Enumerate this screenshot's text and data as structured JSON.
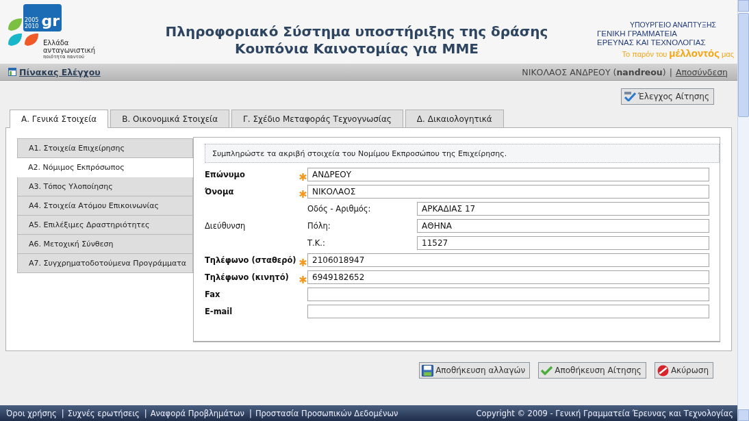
{
  "header": {
    "logo": {
      "mark": "gr",
      "years": [
        "2005",
        "2010"
      ],
      "lines": [
        "Ελλάδα",
        "ανταγωνιστική"
      ],
      "tagline": "ποιότητα παντού"
    },
    "title": [
      "Πληροφοριακό Σύστημα υποστήριξης της δράσης",
      "Κουπόνια Καινοτομίας για ΜΜΕ"
    ],
    "ministry": {
      "lines": [
        "ΥΠΟΥΡΓΕΙΟ ΑΝΑΠΤΥΞΗΣ",
        "ΓΕΝΙΚΗ ΓΡΑΜΜΑΤΕΙΑ",
        "ΕΡΕΥΝΑΣ ΚΑΙ ΤΕΧΝΟΛΟΓΙΑΣ"
      ],
      "motto": [
        "Το παρόν του",
        "μέλλοντός",
        "μας"
      ]
    }
  },
  "navbar": {
    "dashboard": "Πίνακας Ελέγχου",
    "user": "ΝΙΚΟΛΑΟΣ ΑΝΔΡΕΟΥ (**nandreou**)",
    "separator": "|",
    "logout": "Αποσύνδεση"
  },
  "check_button": "Έλεγχος Αίτησης",
  "tabs": [
    {
      "label": "Α. Γενικά Στοιχεία",
      "selected": true
    },
    {
      "label": "Β. Οικονομικά Στοιχεία",
      "selected": false
    },
    {
      "label": "Γ. Σχέδιο Μεταφοράς Τεχνογνωσίας",
      "selected": false
    },
    {
      "label": "Δ. Δικαιολογητικά",
      "selected": false
    }
  ],
  "sidebar": {
    "items": [
      {
        "label": "Α1. Στοιχεία Επιχείρησης",
        "selected": false
      },
      {
        "label": "Α2. Νόμιμος Εκπρόσωπος",
        "selected": true
      },
      {
        "label": "Α3. Τόπος Υλοποίησης",
        "selected": false
      },
      {
        "label": "Α4. Στοιχεία Ατόμου Επικοινωνίας",
        "selected": false
      },
      {
        "label": "Α5. Επιλέξιμες Δραστηριότητες",
        "selected": false
      },
      {
        "label": "Α6. Μετοχική Σύνθεση",
        "selected": false
      },
      {
        "label": "Α7. Συγχρηματοδοτούμενα Προγράμματα",
        "selected": false
      }
    ]
  },
  "form": {
    "instructions": "Συμπληρώστε τα ακριβή στοιχεία του Νομίμου Εκπροσώπου της Επιχείρησης.",
    "rows": [
      {
        "kind": "field",
        "label": "Επώνυμο",
        "bold": true,
        "required": true,
        "value": "ΑΝΔΡΕΟΥ"
      },
      {
        "kind": "field",
        "label": "Όνομα",
        "bold": true,
        "required": true,
        "value": "ΝΙΚΟΛΑΟΣ"
      },
      {
        "kind": "group",
        "label": "Διεύθυνση",
        "bold": false,
        "subfields": [
          {
            "label": "Οδός - Αριθμός:",
            "value": "ΑΡΚΑΔΙΑΣ 17"
          },
          {
            "label": "Πόλη:",
            "value": "ΑΘΗΝΑ"
          },
          {
            "label": "Τ.Κ.:",
            "value": "11527"
          }
        ]
      },
      {
        "kind": "field",
        "label": "Τηλέφωνο (σταθερό)",
        "bold": true,
        "required": true,
        "value": "2106018947"
      },
      {
        "kind": "field",
        "label": "Τηλέφωνο (κινητό)",
        "bold": true,
        "required": true,
        "value": "6949182652"
      },
      {
        "kind": "field",
        "label": "Fax",
        "bold": true,
        "required": false
      },
      {
        "kind": "field",
        "label": "E-mail",
        "bold": true,
        "required": false
      }
    ]
  },
  "actions": [
    {
      "kind": "save",
      "label": "Αποθήκευση αλλαγών"
    },
    {
      "kind": "submit",
      "label": "Αποθήκευση Αίτησης"
    },
    {
      "kind": "cancel",
      "label": "Ακύρωση"
    }
  ],
  "footer": {
    "links": [
      "Όροι χρήσης",
      "Συχνές ερωτήσεις",
      "Αναφορά Προβλημάτων",
      "Προστασία Προσωπικών Δεδομένων"
    ],
    "separator": "|",
    "copyright": "Copyright © 2009 - Γενική Γραμματεία Έρευνας και Τεχνολογίας"
  }
}
